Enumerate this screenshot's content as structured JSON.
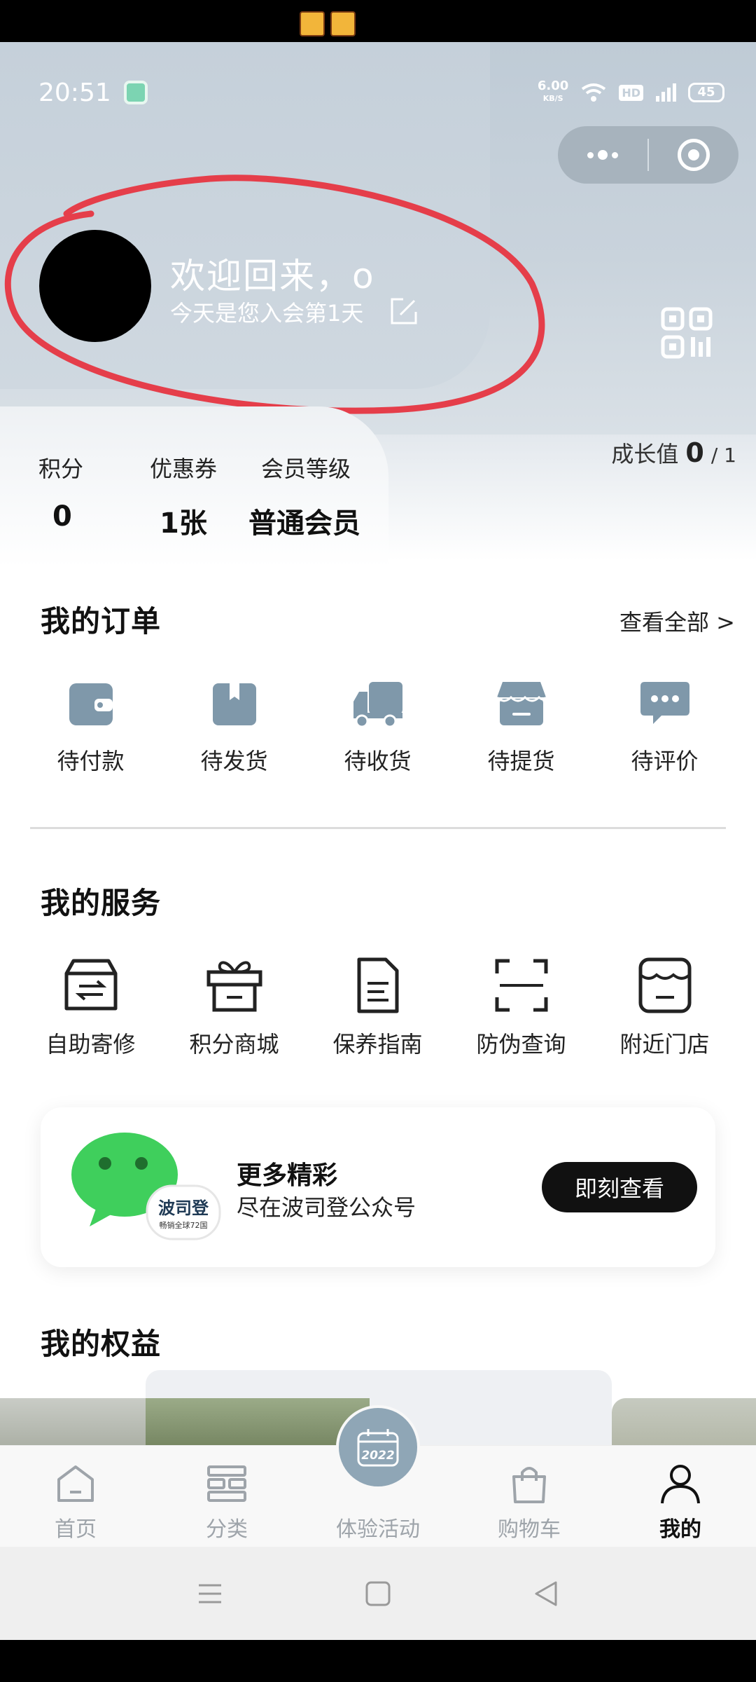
{
  "status_bar": {
    "time": "20:51",
    "network_speed": "6.00",
    "network_unit": "KB/S",
    "hd": "HD",
    "signal": "4G",
    "battery": "45"
  },
  "capsule": {
    "more_icon": "more-dots-icon",
    "close_icon": "target-close-icon"
  },
  "profile": {
    "welcome": "欢迎回来，o",
    "join_days": "今天是您入会第1天",
    "avatar_color": "#000000"
  },
  "growth": {
    "label": "成长值",
    "value": "0",
    "total": "/ 1"
  },
  "stats": [
    {
      "label": "积分",
      "value": "0"
    },
    {
      "label": "优惠券",
      "value": "1张"
    },
    {
      "label": "会员等级",
      "value": "普通会员"
    }
  ],
  "orders": {
    "title": "我的订单",
    "view_all": "查看全部 >",
    "items": [
      {
        "label": "待付款",
        "icon": "wallet-icon"
      },
      {
        "label": "待发货",
        "icon": "box-icon"
      },
      {
        "label": "待收货",
        "icon": "truck-icon"
      },
      {
        "label": "待提货",
        "icon": "store-icon"
      },
      {
        "label": "待评价",
        "icon": "comment-icon"
      }
    ]
  },
  "services": {
    "title": "我的服务",
    "items": [
      {
        "label": "自助寄修",
        "icon": "repair-box-icon"
      },
      {
        "label": "积分商城",
        "icon": "gift-icon"
      },
      {
        "label": "保养指南",
        "icon": "document-icon"
      },
      {
        "label": "防伪查询",
        "icon": "scan-icon"
      },
      {
        "label": "附近门店",
        "icon": "shop-icon"
      }
    ]
  },
  "promo": {
    "title": "更多精彩",
    "subtitle": "尽在波司登公众号",
    "button": "即刻查看",
    "logo_text": "波司登",
    "logo_sub": "畅销全球72国"
  },
  "benefits": {
    "title": "我的权益"
  },
  "tabbar": {
    "items": [
      {
        "label": "首页",
        "icon": "home-icon",
        "active": false
      },
      {
        "label": "分类",
        "icon": "category-icon",
        "active": false
      },
      {
        "label": "体验活动",
        "icon": "calendar-2022-icon",
        "active": false
      },
      {
        "label": "购物车",
        "icon": "bag-icon",
        "active": false
      },
      {
        "label": "我的",
        "icon": "person-icon",
        "active": true
      }
    ],
    "activity_badge": "2022"
  },
  "colors": {
    "hero_bg": "#c5d0da",
    "icon_blue": "#7f98aa",
    "annotation_red": "#e53e4a",
    "button_dark": "#111111"
  }
}
